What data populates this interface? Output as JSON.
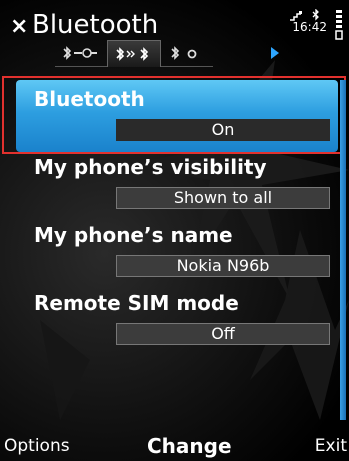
{
  "header": {
    "title": "Bluetooth",
    "close_icon": "close-icon",
    "tabs": [
      {
        "icon": "bluetooth-settings-icon",
        "active": false
      },
      {
        "icon": "bluetooth-devices-icon",
        "active": true
      },
      {
        "icon": "bluetooth-status-icon",
        "active": false
      }
    ],
    "more_tabs_icon": "chevron-right-icon"
  },
  "status_bar": {
    "time": "16:42",
    "icons": [
      "network-icon",
      "bluetooth-icon",
      "battery-icon"
    ]
  },
  "settings": [
    {
      "label": "Bluetooth",
      "value": "On",
      "selected": true
    },
    {
      "label": "My phone’s visibility",
      "value": "Shown to all",
      "selected": false
    },
    {
      "label": "My phone’s name",
      "value": "Nokia N96b",
      "selected": false
    },
    {
      "label": "Remote SIM mode",
      "value": "Off",
      "selected": false
    }
  ],
  "softkeys": {
    "left": "Options",
    "middle": "Change",
    "right": "Exit"
  },
  "colors": {
    "highlight": "#2d9ee0",
    "scrollbar": "#2a8ad6",
    "selection_frame": "#e2312e",
    "tab_arrow": "#2ea6ff"
  }
}
